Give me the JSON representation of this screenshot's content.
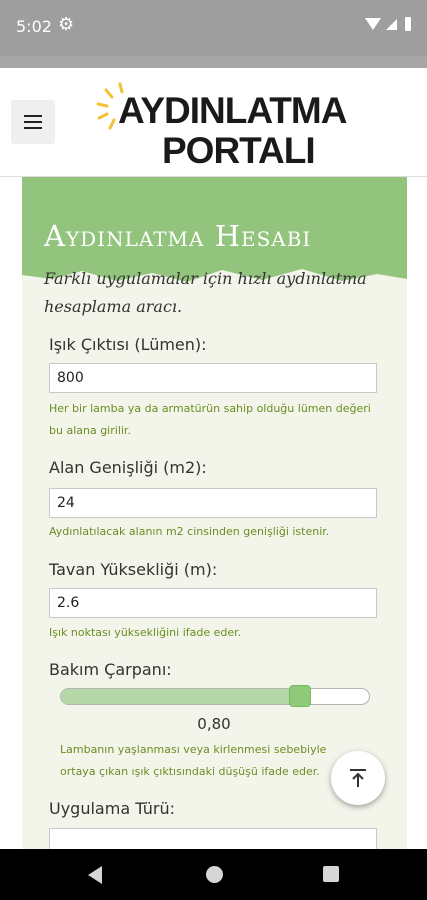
{
  "status": {
    "time": "5:02"
  },
  "header": {
    "logo_line1": "AYDINLATMA",
    "logo_line2": "PORTALI"
  },
  "calculator": {
    "title": "Aydınlatma Hesabı",
    "subtitle": "Farklı uygulamalar için hızlı aydınlatma hesaplama aracı.",
    "lumen": {
      "label": "Işık Çıktısı (Lümen):",
      "value": "800",
      "help": "Her bir lamba ya da armatürün sahip olduğu lümen değeri bu alana girilir."
    },
    "area": {
      "label": "Alan Genişliği (m2):",
      "value": "24",
      "help": "Aydınlatılacak alanın m2 cinsinden genişliği istenir."
    },
    "ceiling": {
      "label": "Tavan Yüksekliği (m):",
      "value": "2.6",
      "help": "Işık noktası yüksekliğini ifade eder."
    },
    "maintenance": {
      "label": "Bakım Çarpanı:",
      "value_text": "0,80",
      "slider_fraction": 0.78,
      "help": "Lambanın yaşlanması veya kirlenmesi sebebiyle ortaya çıkan ışık çıktısındaki düşüşü ifade eder."
    },
    "application": {
      "label": "Uygulama Türü:",
      "value": ""
    }
  },
  "icons": {
    "status": [
      "gear-icon",
      "wifi-icon",
      "signal-icon",
      "battery-icon"
    ],
    "header": [
      "menu-icon",
      "sun-icon"
    ],
    "fab": "arrow-up-to-top-icon",
    "nav": [
      "back-icon",
      "home-icon",
      "recents-icon"
    ]
  },
  "colors": {
    "status_bar": "#9e9e9e",
    "hero_green": "#93c47d",
    "help_text": "#6b8e23",
    "card_bg": "#f3f4ea",
    "slider_fill": "#b6d7a8",
    "slider_thumb": "#8fc97a",
    "sun_yellow": "#f1c232"
  }
}
